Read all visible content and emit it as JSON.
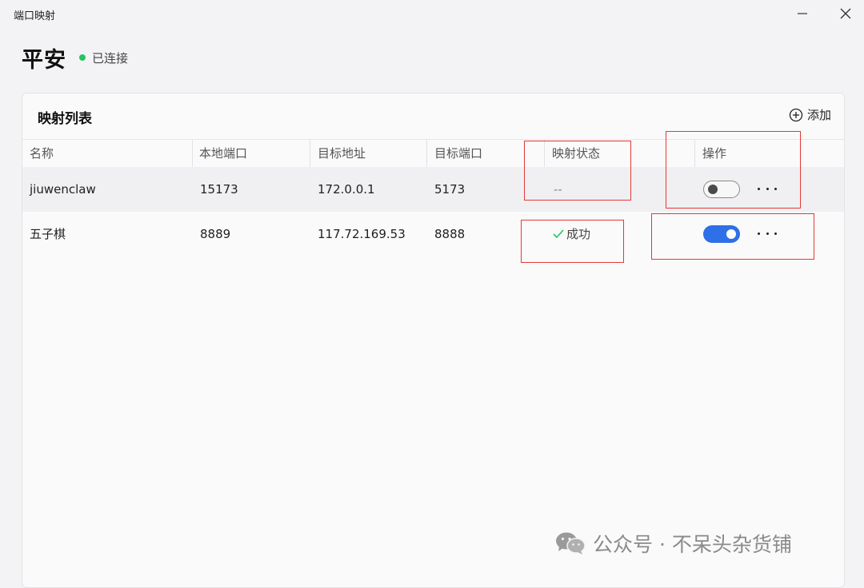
{
  "window": {
    "title": "端口映射",
    "minimize_icon": "minimize-icon",
    "close_icon": "close-icon"
  },
  "header": {
    "device_name": "平安",
    "status": "已连接",
    "status_color": "#22c55e"
  },
  "mapping_list": {
    "title": "映射列表",
    "add_label": "添加",
    "add_icon": "plus-circle-icon",
    "columns": [
      "名称",
      "本地端口",
      "目标地址",
      "目标端口",
      "映射状态",
      "操作"
    ],
    "rows": [
      {
        "name": "jiuwenclaw",
        "local_port": "15173",
        "target_address": "172.0.0.1",
        "target_port": "5173",
        "status": "--",
        "enabled": false
      },
      {
        "name": "五子棋",
        "local_port": "8889",
        "target_address": "117.72.169.53",
        "target_port": "8888",
        "status": "成功",
        "status_icon": "check-icon",
        "enabled": true
      }
    ],
    "toggle_on_color": "#2f6fe8",
    "success_color": "#22c55e"
  },
  "watermark": {
    "text": "公众号 · 不呆头杂货铺",
    "icon": "wechat-icon"
  },
  "annotation_color": "#e53935"
}
